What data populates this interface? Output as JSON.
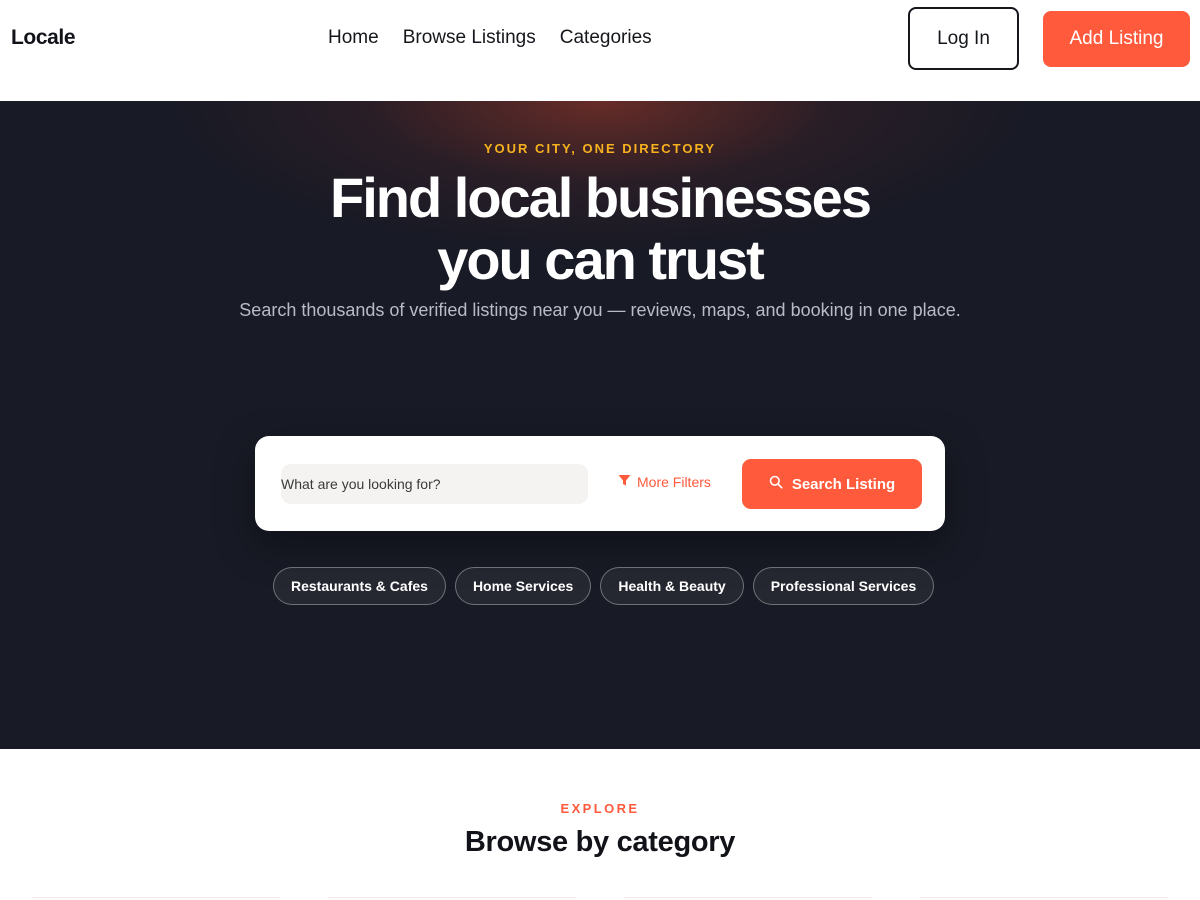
{
  "nav": {
    "logo": "Locale",
    "links": [
      "Home",
      "Browse Listings",
      "Categories"
    ],
    "login_label": "Log In",
    "add_listing_label": "Add Listing"
  },
  "hero": {
    "eyebrow": "YOUR CITY, ONE DIRECTORY",
    "headline_line1": "Find local businesses",
    "headline_line2": "you can trust",
    "subline": "Search thousands of verified listings near you — reviews, maps, and booking in one place.",
    "search": {
      "placeholder": "What are you looking for?",
      "value": "",
      "more_filters_label": "More Filters",
      "search_button_label": "Search Listing",
      "filter_icon": "filter-icon",
      "search_icon": "search-icon"
    },
    "chips": [
      "Restaurants & Cafes",
      "Home Services",
      "Health & Beauty",
      "Professional Services"
    ]
  },
  "explore": {
    "eyebrow": "EXPLORE",
    "title": "Browse by category"
  },
  "colors": {
    "accent": "#ff5a3c",
    "eyebrow_gold": "#f7b21e",
    "hero_bg": "#181a25"
  }
}
